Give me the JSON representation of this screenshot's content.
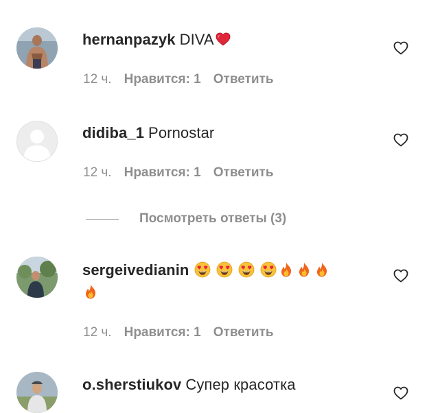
{
  "colors": {
    "text": "#262626",
    "secondary": "#8e8e8e",
    "heart_red": "#ed4956"
  },
  "comments": [
    {
      "username": "hernanpazyk",
      "text": "DIVA",
      "emoji": [
        "red-heart"
      ],
      "time": "12 ч.",
      "likes": "Нравится: 1",
      "reply": "Ответить"
    },
    {
      "username": "didiba_1",
      "text": "Pornostar",
      "emoji": [],
      "time": "12 ч.",
      "likes": "Нравится: 1",
      "reply": "Ответить",
      "view_replies": "Посмотреть ответы (3)"
    },
    {
      "username": "sergeivedianin",
      "text": "",
      "emoji": [
        "heart-eyes-face",
        "heart-eyes-face",
        "heart-eyes-face",
        "heart-eyes-face",
        "fire",
        "fire",
        "fire",
        "fire"
      ],
      "time": "12 ч.",
      "likes": "Нравится: 1",
      "reply": "Ответить"
    },
    {
      "username": "o.sherstiukov",
      "text": "Супер красотка",
      "emoji": [],
      "time": "",
      "likes": "",
      "reply": ""
    }
  ]
}
